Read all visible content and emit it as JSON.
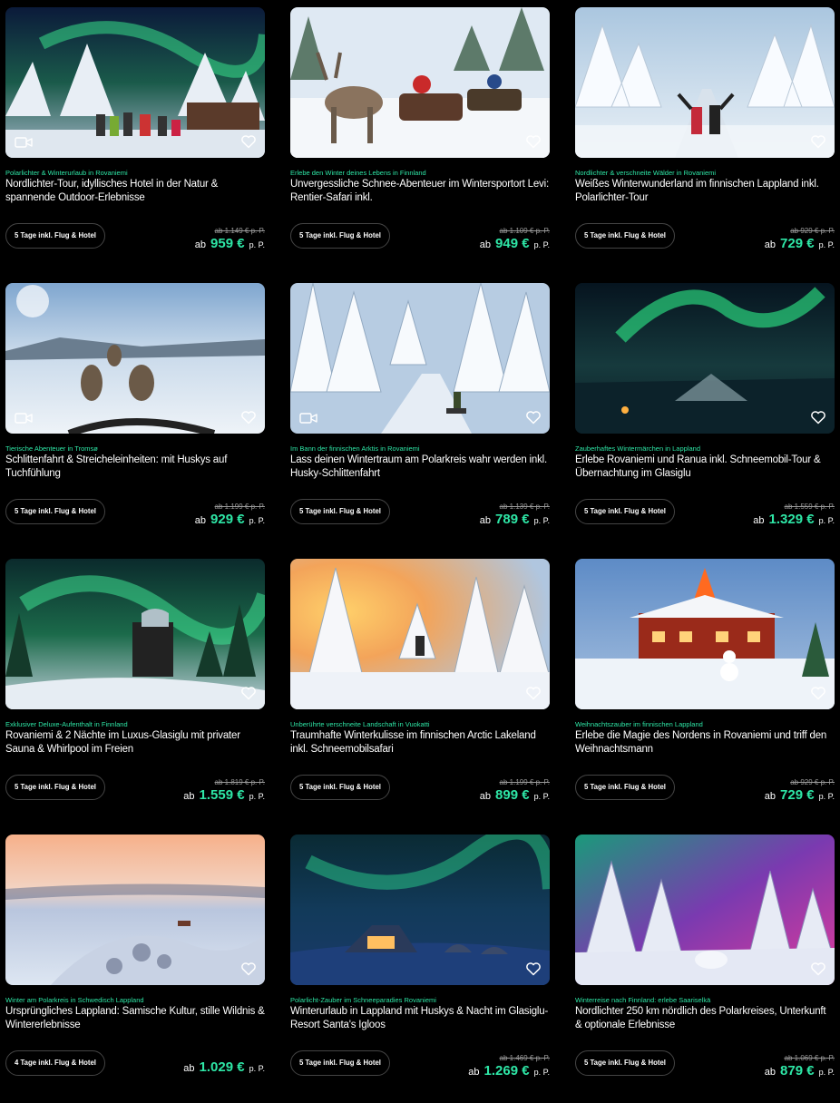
{
  "common": {
    "from": "ab",
    "per_person": "p. P."
  },
  "cards": [
    {
      "subtitle": "Polarlichter & Winterurlaub in Rovaniemi",
      "title": "Nordlichter-Tour, idyllisches Hotel in der Natur & spannende Outdoor-Erlebnisse",
      "tag": "5 Tage inkl. Flug & Hotel",
      "old_price": "ab 1.149 € p. P.",
      "price": "959 €",
      "has_video": true,
      "scene": "aurora-cabin"
    },
    {
      "subtitle": "Erlebe den Winter deines Lebens in Finnland",
      "title": "Unvergessliche Schnee-Abenteuer im Wintersportort Levi: Rentier-Safari inkl.",
      "tag": "5 Tage inkl. Flug & Hotel",
      "old_price": "ab 1.109 € p. P.",
      "price": "949 €",
      "has_video": false,
      "scene": "reindeer"
    },
    {
      "subtitle": "Nordlichter & verschneite Wälder in Rovaniemi",
      "title": "Weißes Winterwunderland im finnischen Lappland inkl. Polarlichter-Tour",
      "tag": "5 Tage inkl. Flug & Hotel",
      "old_price": "ab 929 € p. P.",
      "price": "729 €",
      "has_video": false,
      "scene": "snow-road"
    },
    {
      "subtitle": "Tierische Abenteuer in Tromsø",
      "title": "Schlittenfahrt & Streicheleinheiten: mit Huskys auf Tuchfühlung",
      "tag": "5 Tage inkl. Flug & Hotel",
      "old_price": "ab 1.199 € p. P.",
      "price": "929 €",
      "has_video": true,
      "scene": "huskies"
    },
    {
      "subtitle": "Im Bann der finnischen Arktis in Rovaniemi",
      "title": "Lass deinen Wintertraum am Polarkreis wahr werden inkl. Husky-Schlittenfahrt",
      "tag": "5 Tage inkl. Flug & Hotel",
      "old_price": "ab 1.139 € p. P.",
      "price": "789 €",
      "has_video": true,
      "scene": "forest-sled"
    },
    {
      "subtitle": "Zauberhaftes Wintermärchen in Lappland",
      "title": "Erlebe Rovaniemi und Ranua inkl. Schneemobil-Tour & Übernachtung im Glasiglu",
      "tag": "5 Tage inkl. Flug & Hotel",
      "old_price": "ab 1.559 € p. P.",
      "price": "1.329 €",
      "has_video": false,
      "scene": "aurora-lake"
    },
    {
      "subtitle": "Exklusiver Deluxe-Aufenthalt in Finnland",
      "title": "Rovaniemi & 2 Nächte im Luxus-Glasiglu mit privater Sauna & Whirlpool im Freien",
      "tag": "5 Tage inkl. Flug & Hotel",
      "old_price": "ab 1.819 € p. P.",
      "price": "1.559 €",
      "has_video": false,
      "scene": "aurora-tower"
    },
    {
      "subtitle": "Unberührte verschneite Landschaft in Vuokatti",
      "title": "Traumhafte Winterkulisse im finnischen Arctic Lakeland inkl. Schneemobilsafari",
      "tag": "5 Tage inkl. Flug & Hotel",
      "old_price": "ab 1.199 € p. P.",
      "price": "899 €",
      "has_video": false,
      "scene": "sunset-forest"
    },
    {
      "subtitle": "Weihnachtszauber im finnischen Lappland",
      "title": "Erlebe die Magie des Nordens in Rovaniemi und triff den Weihnachtsmann",
      "tag": "5 Tage inkl. Flug & Hotel",
      "old_price": "ab 929 € p. P.",
      "price": "729 €",
      "has_video": false,
      "scene": "santa-village"
    },
    {
      "subtitle": "Winter am Polarkreis in Schwedisch Lappland",
      "title": "Ursprüngliches Lappland: Samische Kultur, stille Wildnis & Wintererlebnisse",
      "tag": "4 Tage inkl. Flug & Hotel",
      "old_price": "",
      "price": "1.029 €",
      "has_video": false,
      "scene": "aerial-sunset"
    },
    {
      "subtitle": "Polarlicht-Zauber im Schneeparadies Rovaniemi",
      "title": "Winterurlaub in Lappland mit Huskys & Nacht im Glasiglu-Resort Santa's Igloos",
      "tag": "5 Tage inkl. Flug & Hotel",
      "old_price": "ab 1.469 € p. P.",
      "price": "1.269 €",
      "has_video": false,
      "scene": "igloo-night"
    },
    {
      "subtitle": "Winterreise nach Finnland: erlebe Saariselkä",
      "title": "Nordlichter 250 km nördlich des Polarkreises, Unterkunft & optionale Erlebnisse",
      "tag": "5 Tage inkl. Flug & Hotel",
      "old_price": "ab 1.069 € p. P.",
      "price": "879 €",
      "has_video": false,
      "scene": "aurora-pink"
    }
  ]
}
